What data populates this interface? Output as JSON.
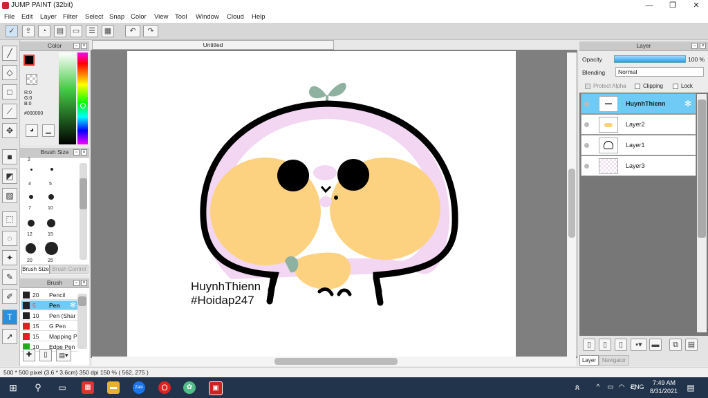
{
  "window": {
    "title": "JUMP PAINT (32bit)",
    "minimize": "—",
    "maximize": "❐",
    "close": "✕"
  },
  "menu": [
    "File",
    "Edit",
    "Layer",
    "Filter",
    "Select",
    "Snap",
    "Color",
    "View",
    "Tool",
    "Window",
    "Cloud",
    "Help"
  ],
  "document_tab": "Untitled",
  "color_panel": {
    "title": "Color",
    "r": "R:0",
    "g": "G:0",
    "b": "B:0",
    "hex": "#000000"
  },
  "brush_size_panel": {
    "title": "Brush Size",
    "sizes": [
      "2",
      "4",
      "5",
      "7",
      "10",
      "12",
      "15",
      "20",
      "25"
    ],
    "tabs": [
      "Brush Size",
      "Brush Control"
    ]
  },
  "brush_panel": {
    "title": "Brush",
    "items": [
      {
        "size": "20",
        "name": "Pencil",
        "color": "#222222"
      },
      {
        "size": "5",
        "name": "Pen",
        "color": "#222222",
        "selected": true
      },
      {
        "size": "10",
        "name": "Pen (Shar",
        "color": "#222222"
      },
      {
        "size": "15",
        "name": "G Pen",
        "color": "#dd2222"
      },
      {
        "size": "15",
        "name": "Mapping P",
        "color": "#dd2222"
      },
      {
        "size": "10",
        "name": "Edge Pen",
        "color": "#22aa22"
      }
    ]
  },
  "layer_panel": {
    "title": "Layer",
    "opacity_label": "Opacity",
    "opacity_value": "100 %",
    "blending_label": "Blending",
    "blending_value": "Normal",
    "protect_alpha": "Protect Alpha",
    "clipping": "Clipping",
    "lock": "Lock",
    "layers": [
      "HuynhThienn",
      "Layer2",
      "Layer1",
      "Layer3"
    ],
    "tabs": [
      "Layer",
      "Navigator"
    ]
  },
  "artwork": {
    "line1": "HuynhThienn",
    "line2": "#Hoidap247"
  },
  "status_bar": {
    "text": "500 * 500 pixel   (3.6 * 3.6cm)   350 dpi   150 %   ( 562, 275 )"
  },
  "taskbar": {
    "time": "7:49 AM",
    "date": "8/31/2021",
    "lang": "ENG",
    "app_zalo": "Zalo"
  },
  "colors": {
    "accent": "#2a8fdc",
    "layer_selected": "#6fcbf5",
    "taskbar": "#21344c",
    "peach": "#fcd281",
    "pink": "#f2d6f2",
    "sprout": "#8fb1a0"
  }
}
